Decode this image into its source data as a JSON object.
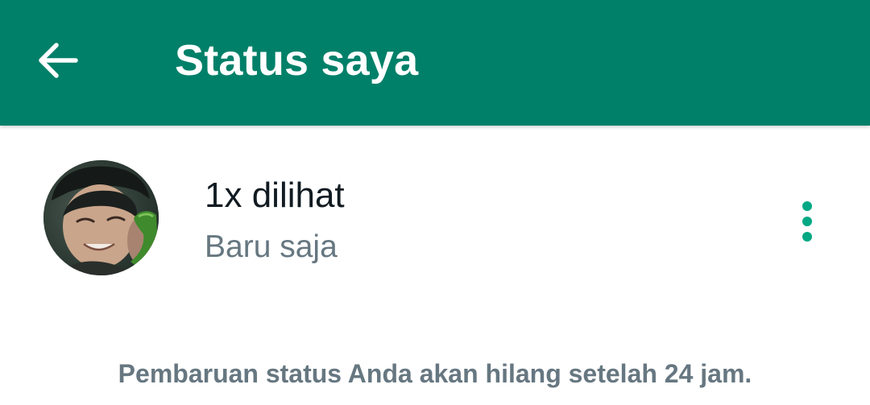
{
  "header": {
    "title": "Status saya",
    "back_icon": "arrow-left-icon",
    "background_color": "#008069"
  },
  "status": {
    "views": "1x dilihat",
    "time": "Baru saja",
    "menu_icon": "more-vertical-icon",
    "menu_color": "#00a884"
  },
  "footer": {
    "note": "Pembaruan status Anda akan hilang setelah 24 jam."
  }
}
